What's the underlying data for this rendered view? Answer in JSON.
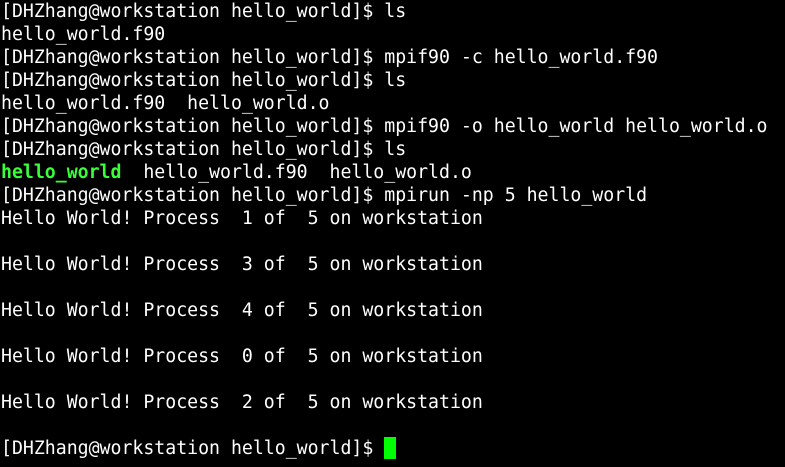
{
  "terminal": {
    "prompt": "[DHZhang@workstation hello_world]$ ",
    "commands": {
      "c1": "ls",
      "c2": "mpif90 -c hello_world.f90",
      "c3": "ls",
      "c4": "mpif90 -o hello_world hello_world.o",
      "c5": "ls",
      "c6": "mpirun -np 5 hello_world"
    },
    "output": {
      "o1": "hello_world.f90",
      "o2": "hello_world.f90  hello_world.o",
      "ls3_exec": "hello_world",
      "ls3_rest": "  hello_world.f90  hello_world.o",
      "run1": "Hello World! Process  1 of  5 on workstation",
      "run2": "Hello World! Process  3 of  5 on workstation",
      "run3": "Hello World! Process  4 of  5 on workstation",
      "run4": "Hello World! Process  0 of  5 on workstation",
      "run5": "Hello World! Process  2 of  5 on workstation"
    },
    "colors": {
      "background": "#000000",
      "text": "#ffffff",
      "executable": "#39ff39",
      "cursor": "#00ff00"
    }
  }
}
